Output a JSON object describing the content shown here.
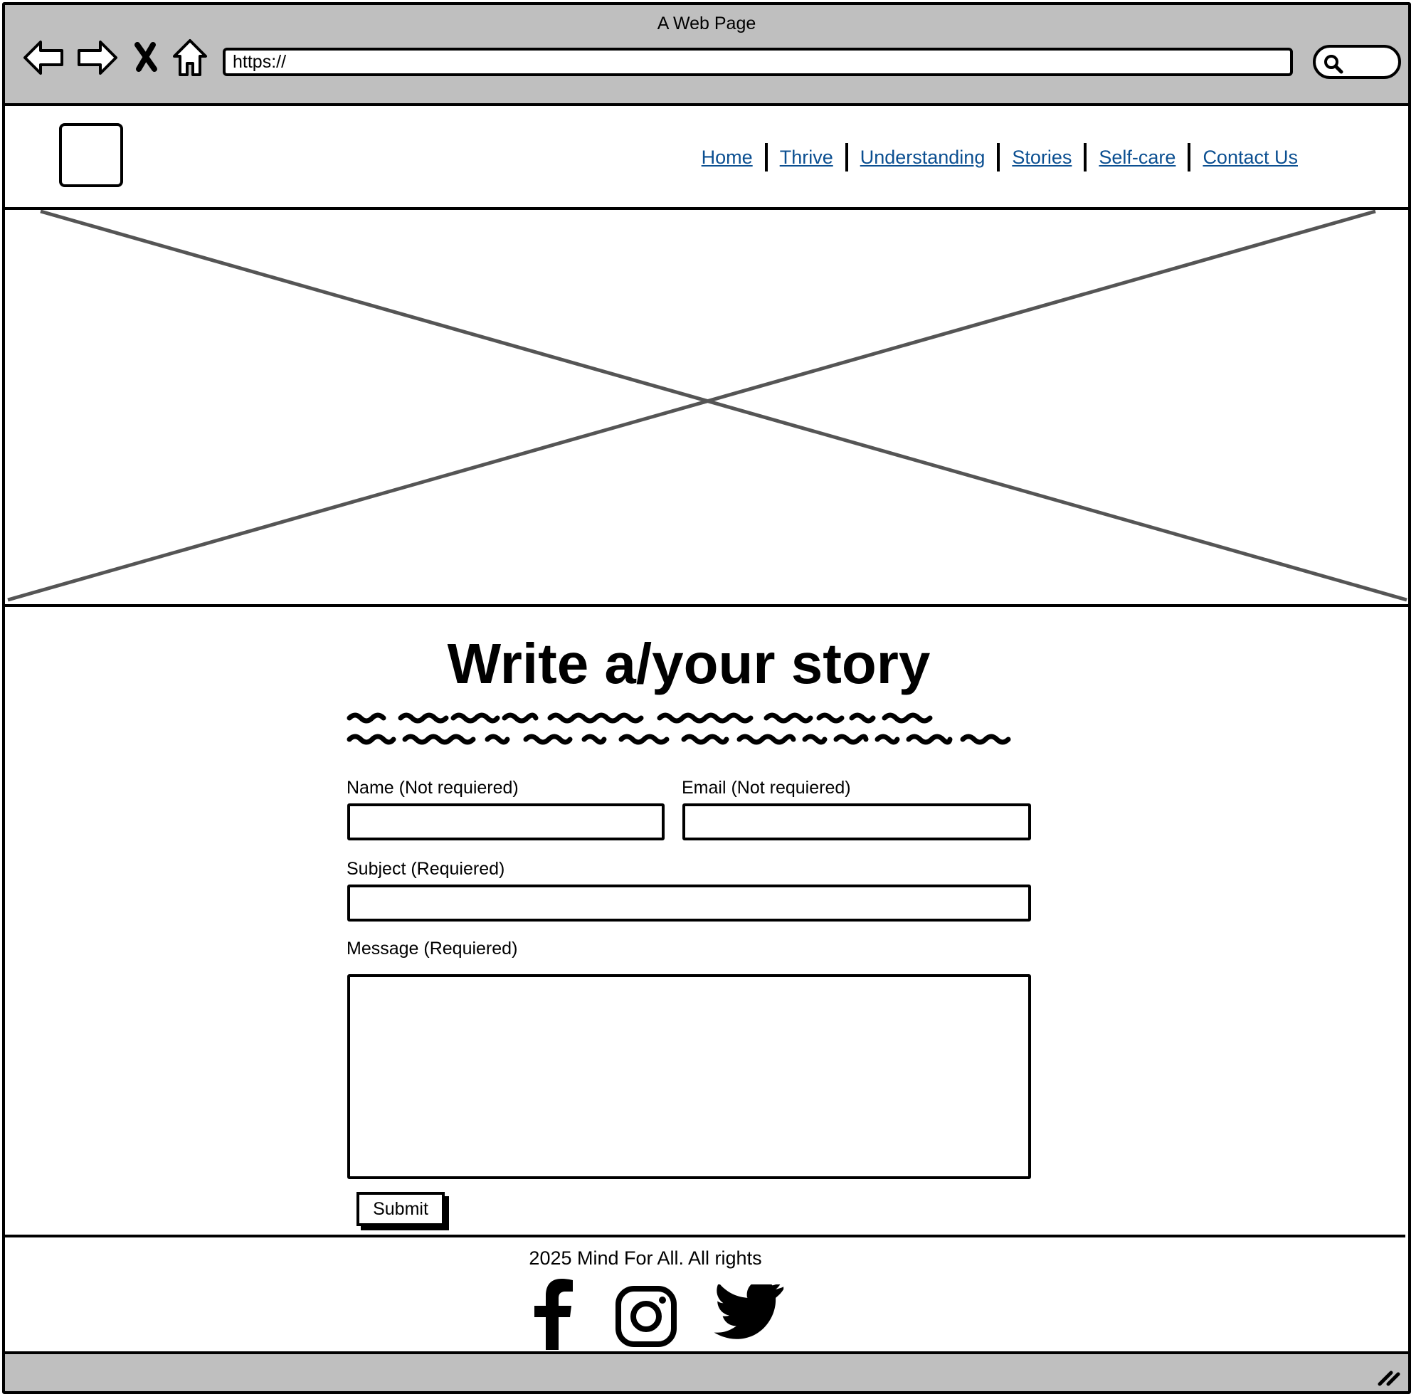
{
  "window": {
    "title": "A Web Page"
  },
  "browser": {
    "url": "https://",
    "icons": [
      "back-arrow-icon",
      "forward-arrow-icon",
      "close-icon",
      "home-icon",
      "search-icon"
    ]
  },
  "nav": {
    "items": [
      {
        "label": "Home"
      },
      {
        "label": "Thrive"
      },
      {
        "label": "Understanding"
      },
      {
        "label": "Stories"
      },
      {
        "label": "Self-care"
      },
      {
        "label": "Contact Us"
      }
    ],
    "link_color": "#0b4f91"
  },
  "page": {
    "title": "Write a/your story"
  },
  "form": {
    "name_label": "Name (Not requiered)",
    "email_label": "Email (Not requiered)",
    "subject_label": "Subject (Requiered)",
    "message_label": "Message (Requiered)",
    "submit_label": "Submit"
  },
  "footer": {
    "text": "2025 Mind For All. All rights",
    "social": [
      "facebook-icon",
      "instagram-icon",
      "twitter-icon"
    ]
  },
  "colors": {
    "chrome": "#bfbfbf",
    "placeholder_line": "#555555"
  }
}
